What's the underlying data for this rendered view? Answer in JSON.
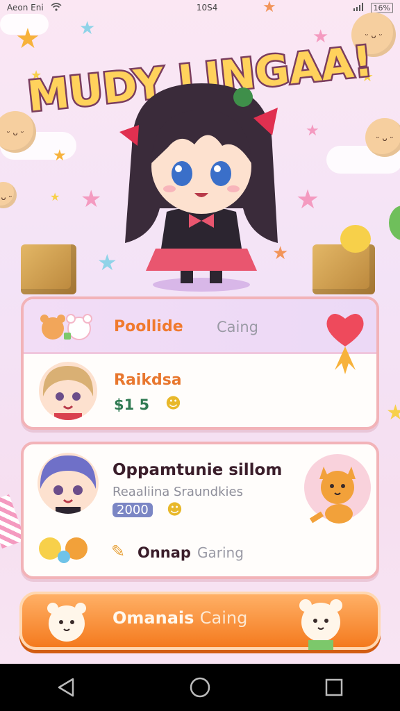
{
  "status": {
    "carrier": "Aeon Eni",
    "time": "10S4",
    "battery": "16%"
  },
  "title": "MUDY LINGAA!",
  "card1": {
    "header_label": "Poollide",
    "header_sub": "Caing",
    "item_label": "Raikdsa",
    "item_score": "$1 5"
  },
  "card2": {
    "title": "Oppamtunie sillom",
    "subtitle": "Reaaliina Sraundkies",
    "score": "2000",
    "footer_label": "Onnap",
    "footer_sub": "Garing"
  },
  "play_button": {
    "label": "Omanais",
    "sub": "Caing"
  },
  "icons": {
    "nav_back": "back-icon",
    "nav_home": "home-icon",
    "nav_recent": "recent-apps-icon"
  },
  "colors": {
    "accent_orange": "#f47a1e",
    "card_border": "#f2b3b8"
  }
}
